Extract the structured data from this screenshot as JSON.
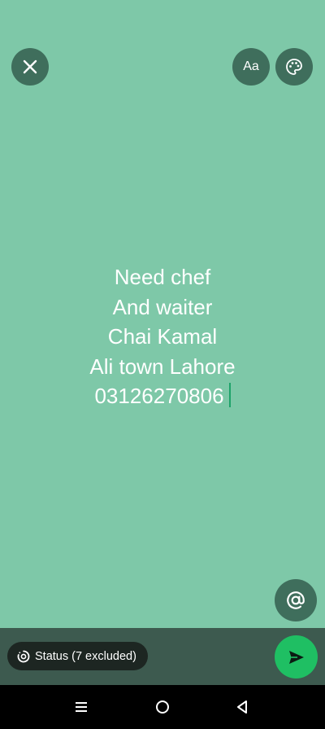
{
  "status_text": {
    "lines": [
      "Need chef",
      "And waiter",
      "Chai Kamal",
      "Ali town Lahore",
      "03126270806"
    ]
  },
  "toolbar": {
    "font_label": "Aa"
  },
  "privacy": {
    "label": "Status (7 excluded)"
  },
  "icons": {
    "close": "close-icon",
    "font": "text-font-icon",
    "palette": "palette-icon",
    "mention": "at-mention-icon",
    "privacy": "status-privacy-icon",
    "send": "send-icon",
    "recents": "recents-icon",
    "home": "home-icon",
    "back": "back-icon"
  },
  "colors": {
    "background": "#7ec8a8",
    "button": "#3f6e5c",
    "bottom_bar": "#3d5a4f",
    "send": "#1fbf63",
    "caret": "#1ea36a"
  }
}
